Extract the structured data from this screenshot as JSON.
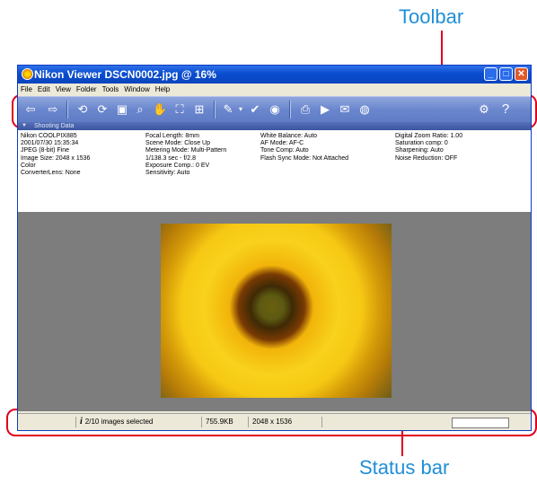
{
  "callouts": {
    "toolbar": "Toolbar",
    "statusbar": "Status bar"
  },
  "window": {
    "title": "Nikon Viewer DSCN0002.jpg @ 16%"
  },
  "menu": [
    "File",
    "Edit",
    "View",
    "Folder",
    "Tools",
    "Window",
    "Help"
  ],
  "toolbar_icons": [
    "back-arrow-icon",
    "forward-arrow-icon",
    "rotate-left-icon",
    "rotate-right-icon",
    "fit-window-icon",
    "zoom-icon",
    "hand-icon",
    "full-screen-icon",
    "thumbnail-icon",
    "edit-icon",
    "checkmark-icon",
    "protect-icon",
    "print-icon",
    "slideshow-icon",
    "email-icon",
    "web-icon",
    "settings-icon",
    "help-icon"
  ],
  "shooting": {
    "header": "Shooting Data",
    "col1": [
      "Nikon COOLPIX885",
      "2001/07/30 15:35:34",
      "JPEG (8-bit) Fine",
      "Image Size:  2048 x 1536",
      "Color",
      "ConverterLens: None"
    ],
    "col2": [
      "Focal Length: 8mm",
      "Scene Mode: Close Up",
      "Metering Mode: Multi-Pattern",
      "1/138.3 sec - f/2.8",
      "Exposure Comp.: 0 EV",
      "Sensitivity: Auto"
    ],
    "col3": [
      "White Balance: Auto",
      "AF Mode: AF-C",
      "Tone Comp: Auto",
      "Flash Sync Mode: Not Attached"
    ],
    "col4": [
      "Digital Zoom Ratio: 1.00",
      "Saturation comp: 0",
      "Sharpening: Auto",
      "Noise Reduction: OFF"
    ]
  },
  "status": {
    "selected": "2/10 images selected",
    "filesize": "755.9KB",
    "dimensions": "2048 x 1536"
  }
}
